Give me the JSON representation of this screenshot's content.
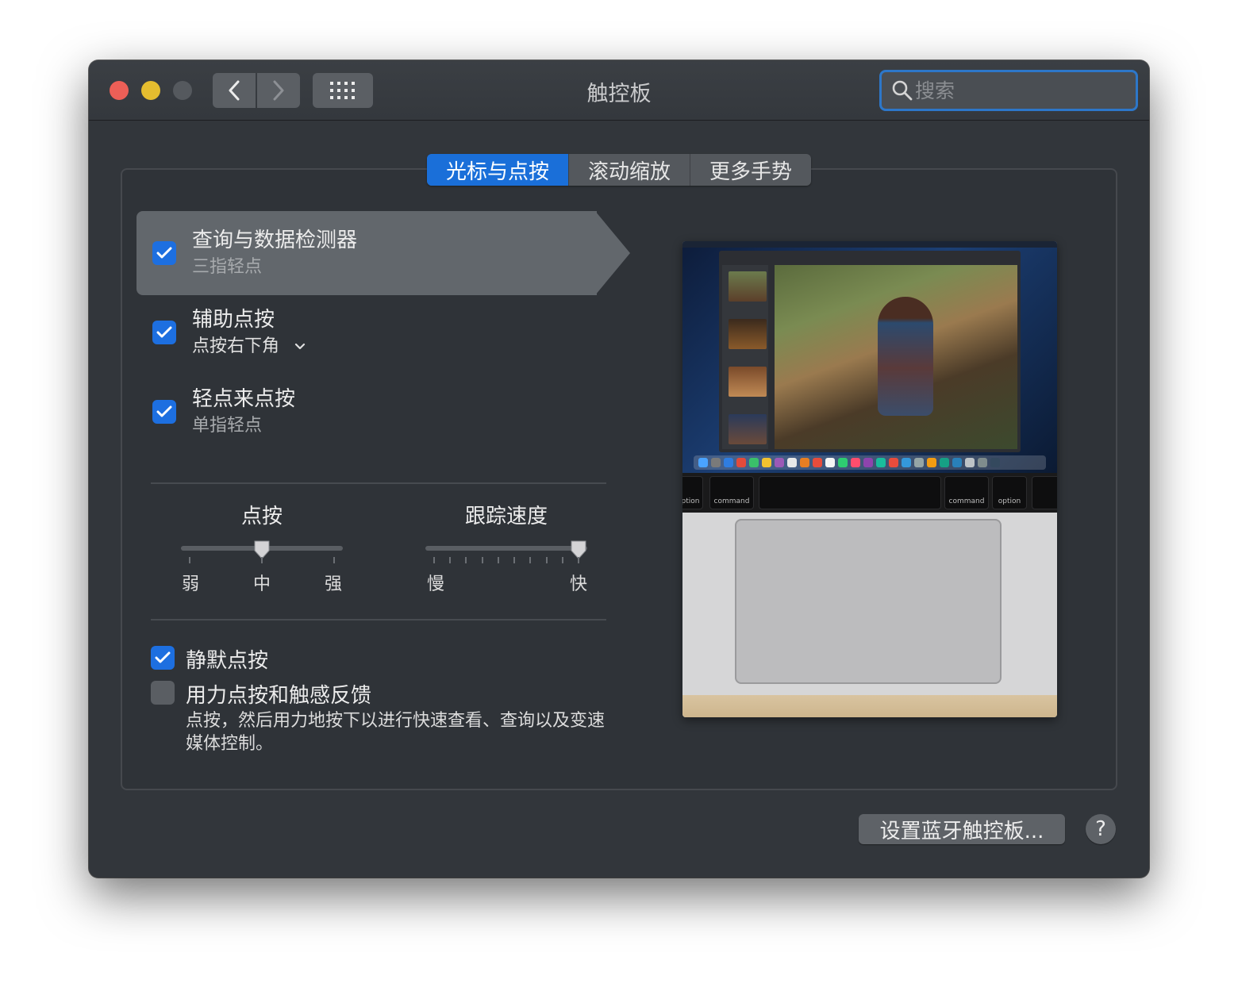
{
  "window": {
    "title": "触控板"
  },
  "search": {
    "placeholder": "搜索",
    "value": ""
  },
  "tabs": [
    {
      "label": "光标与点按",
      "active": true
    },
    {
      "label": "滚动缩放",
      "active": false
    },
    {
      "label": "更多手势",
      "active": false
    }
  ],
  "options": [
    {
      "title": "查询与数据检测器",
      "subtitle": "三指轻点",
      "checked": true,
      "selected": true
    },
    {
      "title": "辅助点按",
      "subtitle": "点按右下角",
      "checked": true,
      "selected": false,
      "has_dropdown": true
    },
    {
      "title": "轻点来点按",
      "subtitle": "单指轻点",
      "checked": true,
      "selected": false
    }
  ],
  "sliders": {
    "click": {
      "title": "点按",
      "labels": [
        "弱",
        "中",
        "强"
      ],
      "tick_count": 3,
      "value_fraction": 0.5
    },
    "tracking": {
      "title": "跟踪速度",
      "labels": [
        "慢",
        "快"
      ],
      "tick_count": 10,
      "value_fraction": 1.0
    }
  },
  "bottom_options": {
    "silent_click": {
      "label": "静默点按",
      "checked": true
    },
    "force_click": {
      "label": "用力点按和触感反馈",
      "checked": false,
      "description": "点按，然后用力地按下以进行快速查看、查询以及变速媒体控制。"
    }
  },
  "touchbar_keys": [
    "ption",
    "command",
    "command",
    "option"
  ],
  "buttons": {
    "bluetooth": "设置蓝牙触控板...",
    "help": "?"
  },
  "colors": {
    "accent": "#1a6fd9",
    "window_bg": "#32363b",
    "close": "#ec5f57",
    "minimize": "#e5bd2f"
  }
}
